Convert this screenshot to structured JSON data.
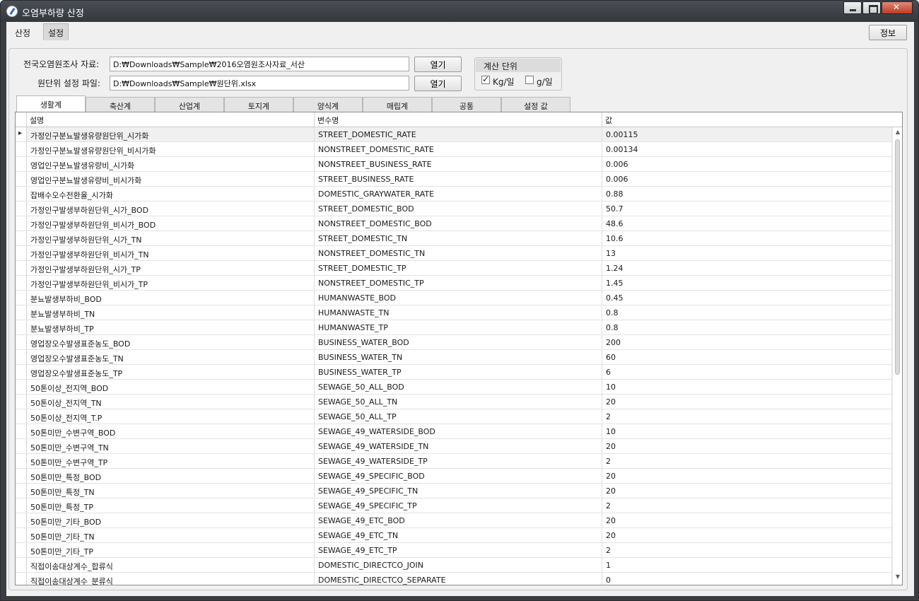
{
  "window": {
    "title": "오염부하량 산정"
  },
  "top_tabs": [
    "산정",
    "설정"
  ],
  "info_button": "정보",
  "data_source": {
    "survey_label": "전국오염원조사 자료:",
    "survey_path": "D:₩Downloads₩Sample₩2016오염원조사자료_서산",
    "unit_file_label": "원단위 설정 파일:",
    "unit_file_path": "D:₩Downloads₩Sample₩원단위.xlsx",
    "open_label": "열기"
  },
  "calc_unit": {
    "title": "계산 단위",
    "options": [
      {
        "label": "Kg/일",
        "checked": true
      },
      {
        "label": "g/일",
        "checked": false
      }
    ]
  },
  "sub_tabs": [
    "생활계",
    "축산계",
    "산업계",
    "토지계",
    "양식계",
    "매립계",
    "공통",
    "설정 값"
  ],
  "table": {
    "columns": [
      "설명",
      "변수명",
      "값"
    ],
    "rows": [
      [
        "가정인구분뇨발생유량원단위_시가화",
        "STREET_DOMESTIC_RATE",
        "0.00115"
      ],
      [
        "가정인구분뇨발생유량원단위_비시가화",
        "NONSTREET_DOMESTIC_RATE",
        "0.00134"
      ],
      [
        "영업인구분뇨발생유량비_시가화",
        "NONSTREET_BUSINESS_RATE",
        "0.006"
      ],
      [
        "영업인구분뇨발생유량비_비시가화",
        "STREET_BUSINESS_RATE",
        "0.006"
      ],
      [
        "잡배수오수전환율_시가화",
        "DOMESTIC_GRAYWATER_RATE",
        "0.88"
      ],
      [
        "가정인구발생부하원단위_시가_BOD",
        "STREET_DOMESTIC_BOD",
        "50.7"
      ],
      [
        "가정인구발생부하원단위_비시가_BOD",
        "NONSTREET_DOMESTIC_BOD",
        "48.6"
      ],
      [
        "가정인구발생부하원단위_시가_TN",
        "STREET_DOMESTIC_TN",
        "10.6"
      ],
      [
        "가정인구발생부하원단위_비시가_TN",
        "NONSTREET_DOMESTIC_TN",
        "13"
      ],
      [
        "가정인구발생부하원단위_시가_TP",
        "STREET_DOMESTIC_TP",
        "1.24"
      ],
      [
        "가정인구발생부하원단위_비시가_TP",
        "NONSTREET_DOMESTIC_TP",
        "1.45"
      ],
      [
        "분뇨발생부하비_BOD",
        "HUMANWASTE_BOD",
        "0.45"
      ],
      [
        "분뇨발생부하비_TN",
        "HUMANWASTE_TN",
        "0.8"
      ],
      [
        "분뇨발생부하비_TP",
        "HUMANWASTE_TP",
        "0.8"
      ],
      [
        "영업장오수발생표준농도_BOD",
        "BUSINESS_WATER_BOD",
        "200"
      ],
      [
        "영업장오수발생표준농도_TN",
        "BUSINESS_WATER_TN",
        "60"
      ],
      [
        "영업장오수발생표준농도_TP",
        "BUSINESS_WATER_TP",
        "6"
      ],
      [
        "50톤이상_전지역_BOD",
        "SEWAGE_50_ALL_BOD",
        "10"
      ],
      [
        "50톤이상_전지역_TN",
        "SEWAGE_50_ALL_TN",
        "20"
      ],
      [
        "50톤이상_전지역_T.P",
        "SEWAGE_50_ALL_TP",
        "2"
      ],
      [
        "50톤미만_수변구역_BOD",
        "SEWAGE_49_WATERSIDE_BOD",
        "10"
      ],
      [
        "50톤미만_수변구역_TN",
        "SEWAGE_49_WATERSIDE_TN",
        "20"
      ],
      [
        "50톤미만_수변구역_TP",
        "SEWAGE_49_WATERSIDE_TP",
        "2"
      ],
      [
        "50톤미만_특정_BOD",
        "SEWAGE_49_SPECIFIC_BOD",
        "20"
      ],
      [
        "50톤미만_특정_TN",
        "SEWAGE_49_SPECIFIC_TN",
        "20"
      ],
      [
        "50톤미만_특정_TP",
        "SEWAGE_49_SPECIFIC_TP",
        "2"
      ],
      [
        "50톤미만_기타_BOD",
        "SEWAGE_49_ETC_BOD",
        "20"
      ],
      [
        "50톤미만_기타_TN",
        "SEWAGE_49_ETC_TN",
        "20"
      ],
      [
        "50톤미만_기타_TP",
        "SEWAGE_49_ETC_TP",
        "2"
      ],
      [
        "직접이송대상계수_합류식",
        "DOMESTIC_DIRECTCO_JOIN",
        "1"
      ],
      [
        "직접이송대상계수_분류식",
        "DOMESTIC_DIRECTCO_SEPARATE",
        "0"
      ]
    ]
  }
}
